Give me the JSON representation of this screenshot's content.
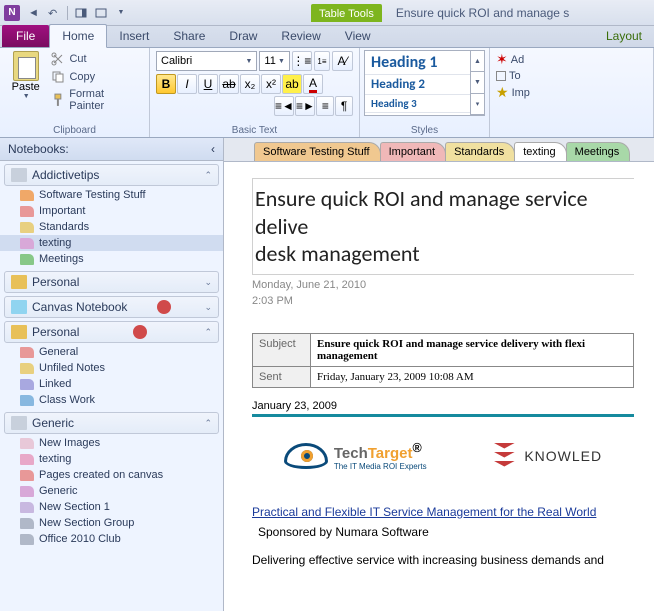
{
  "title": "Ensure quick ROI and manage s",
  "context_tab": "Table Tools",
  "ribbon_tabs": {
    "file": "File",
    "home": "Home",
    "insert": "Insert",
    "share": "Share",
    "draw": "Draw",
    "review": "Review",
    "view": "View",
    "layout": "Layout"
  },
  "clipboard": {
    "paste": "Paste",
    "cut": "Cut",
    "copy": "Copy",
    "format_painter": "Format Painter",
    "group": "Clipboard"
  },
  "basic_text": {
    "font": "Calibri",
    "size": "11",
    "group": "Basic Text"
  },
  "styles": {
    "h1": "Heading 1",
    "h2": "Heading 2",
    "h3": "Heading 3",
    "group": "Styles"
  },
  "extras": {
    "ad": "Ad",
    "to": "To",
    "imp": "Imp"
  },
  "sidebar": {
    "header": "Notebooks:",
    "notebooks": [
      {
        "name": "Addictivetips",
        "color": "#c8d0dc",
        "sync": false,
        "expanded": true,
        "sections": [
          {
            "name": "Software Testing Stuff",
            "color": "#f0a868"
          },
          {
            "name": "Important",
            "color": "#e89898"
          },
          {
            "name": "Standards",
            "color": "#e8d080"
          },
          {
            "name": "texting",
            "color": "#d8a8d8",
            "selected": true
          },
          {
            "name": "Meetings",
            "color": "#88c888"
          }
        ]
      },
      {
        "name": "Personal",
        "color": "#e8c058",
        "sync": false,
        "expanded": false,
        "sections": []
      },
      {
        "name": "Canvas Notebook",
        "color": "#90d4f0",
        "sync": true,
        "expanded": false,
        "sections": []
      },
      {
        "name": "Personal",
        "color": "#e8c058",
        "sync": true,
        "expanded": true,
        "sections": [
          {
            "name": "General",
            "color": "#e89898"
          },
          {
            "name": "Unfiled Notes",
            "color": "#e8d080"
          },
          {
            "name": "Linked",
            "color": "#a8a8e0"
          },
          {
            "name": "Class Work",
            "color": "#88b8e0"
          }
        ]
      },
      {
        "name": "Generic",
        "color": "#c8d0dc",
        "sync": false,
        "expanded": true,
        "sections": [
          {
            "name": "New Images",
            "color": "#e8c8d8"
          },
          {
            "name": "texting",
            "color": "#e8a8c8"
          },
          {
            "name": "Pages created on canvas",
            "color": "#e89898"
          },
          {
            "name": "Generic",
            "color": "#d8a8d8"
          },
          {
            "name": "New Section 1",
            "color": "#c8b8e0"
          },
          {
            "name": "New Section Group",
            "color": "#b0b8c8",
            "group": true
          },
          {
            "name": "Office 2010 Club",
            "color": "#b0b8c8",
            "group": true
          }
        ]
      }
    ]
  },
  "page_tabs": [
    {
      "label": "Software Testing Stuff",
      "color": "#f0c890"
    },
    {
      "label": "Important",
      "color": "#f0b8b8"
    },
    {
      "label": "Standards",
      "color": "#f0e0a0"
    },
    {
      "label": "texting",
      "color": "#ffffff",
      "active": true
    },
    {
      "label": "Meetings",
      "color": "#a8d8a8"
    }
  ],
  "page": {
    "title": "Ensure quick ROI and manage service delive desk management",
    "title_l1": "Ensure quick ROI and manage service delive",
    "title_l2": "desk management",
    "date": "Monday, June 21, 2010",
    "time": "2:03 PM",
    "email": {
      "subject_label": "Subject",
      "subject": "Ensure quick ROI and manage service delivery with flexi management",
      "sent_label": "Sent",
      "sent": "Friday, January 23, 2009 10:08 AM"
    },
    "divider_date": "January 23, 2009",
    "techtarget": {
      "name_tech": "Tech",
      "name_target": "Target",
      "reg": "®",
      "tag": "The IT Media ROI Experts"
    },
    "knowledge": "KNOWLED",
    "link": "Practical and Flexible IT Service Management for the Real World",
    "sponsor": "Sponsored by Numara Software",
    "body": "Delivering effective service with increasing business demands and"
  }
}
